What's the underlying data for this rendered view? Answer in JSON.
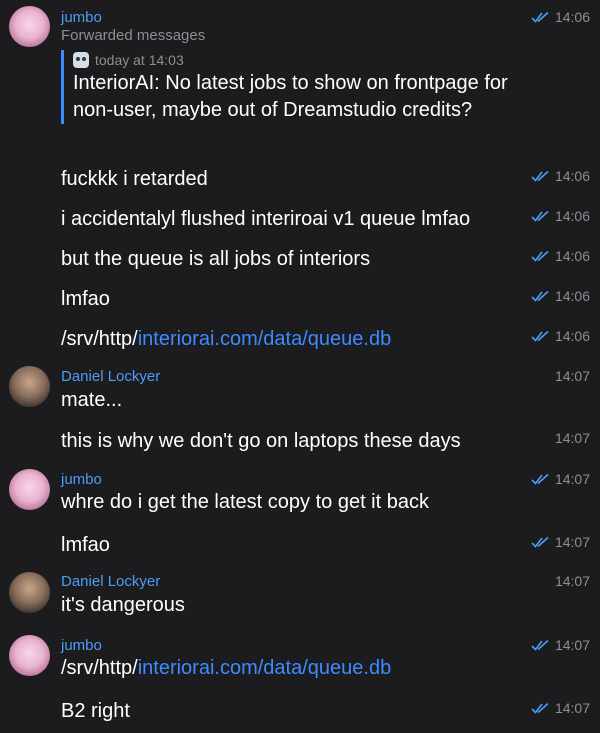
{
  "messages": [
    {
      "id": "m1",
      "sender": "jumbo",
      "forward_label": "Forwarded messages",
      "time": "14:06",
      "quote": {
        "time": "today at 14:03",
        "text": "InteriorAI: No latest jobs to show on frontpage for non-user, maybe out of Dreamstudio credits?"
      }
    },
    {
      "id": "m2",
      "text": "fuckkk i retarded",
      "time": "14:06"
    },
    {
      "id": "m3",
      "text": "i accidentalyl flushed interiroai v1 queue lmfao",
      "time": "14:06"
    },
    {
      "id": "m4",
      "text": "but the queue is all jobs of interiors",
      "time": "14:06"
    },
    {
      "id": "m5",
      "text": "lmfao",
      "time": "14:06"
    },
    {
      "id": "m6",
      "text_prefix": "/srv/http/",
      "link": "interiorai.com/data/queue.db",
      "time": "14:06"
    },
    {
      "id": "m7",
      "sender": "Daniel Lockyer",
      "text": "mate...",
      "time": "14:07"
    },
    {
      "id": "m8",
      "text": "this is why we don't go on laptops these days",
      "time": "14:07"
    },
    {
      "id": "m9",
      "sender": "jumbo",
      "text": "whre do i get the latest copy to get it back",
      "time": "14:07"
    },
    {
      "id": "m10",
      "text": "lmfao",
      "time": "14:07"
    },
    {
      "id": "m11",
      "sender": "Daniel Lockyer",
      "text": "it's dangerous",
      "time": "14:07"
    },
    {
      "id": "m12",
      "sender": "jumbo",
      "text_prefix": "/srv/http/",
      "link": "interiorai.com/data/queue.db",
      "time": "14:07"
    },
    {
      "id": "m13",
      "text": "B2 right",
      "time": "14:07"
    }
  ],
  "colors": {
    "background": "#1c1c1e",
    "sender": "#4d9cf6",
    "link": "#3d8bff",
    "meta": "#8e8e93",
    "text": "#ffffff"
  },
  "icons": {
    "read_receipt": "double-check-icon",
    "bot": "bot-icon"
  }
}
